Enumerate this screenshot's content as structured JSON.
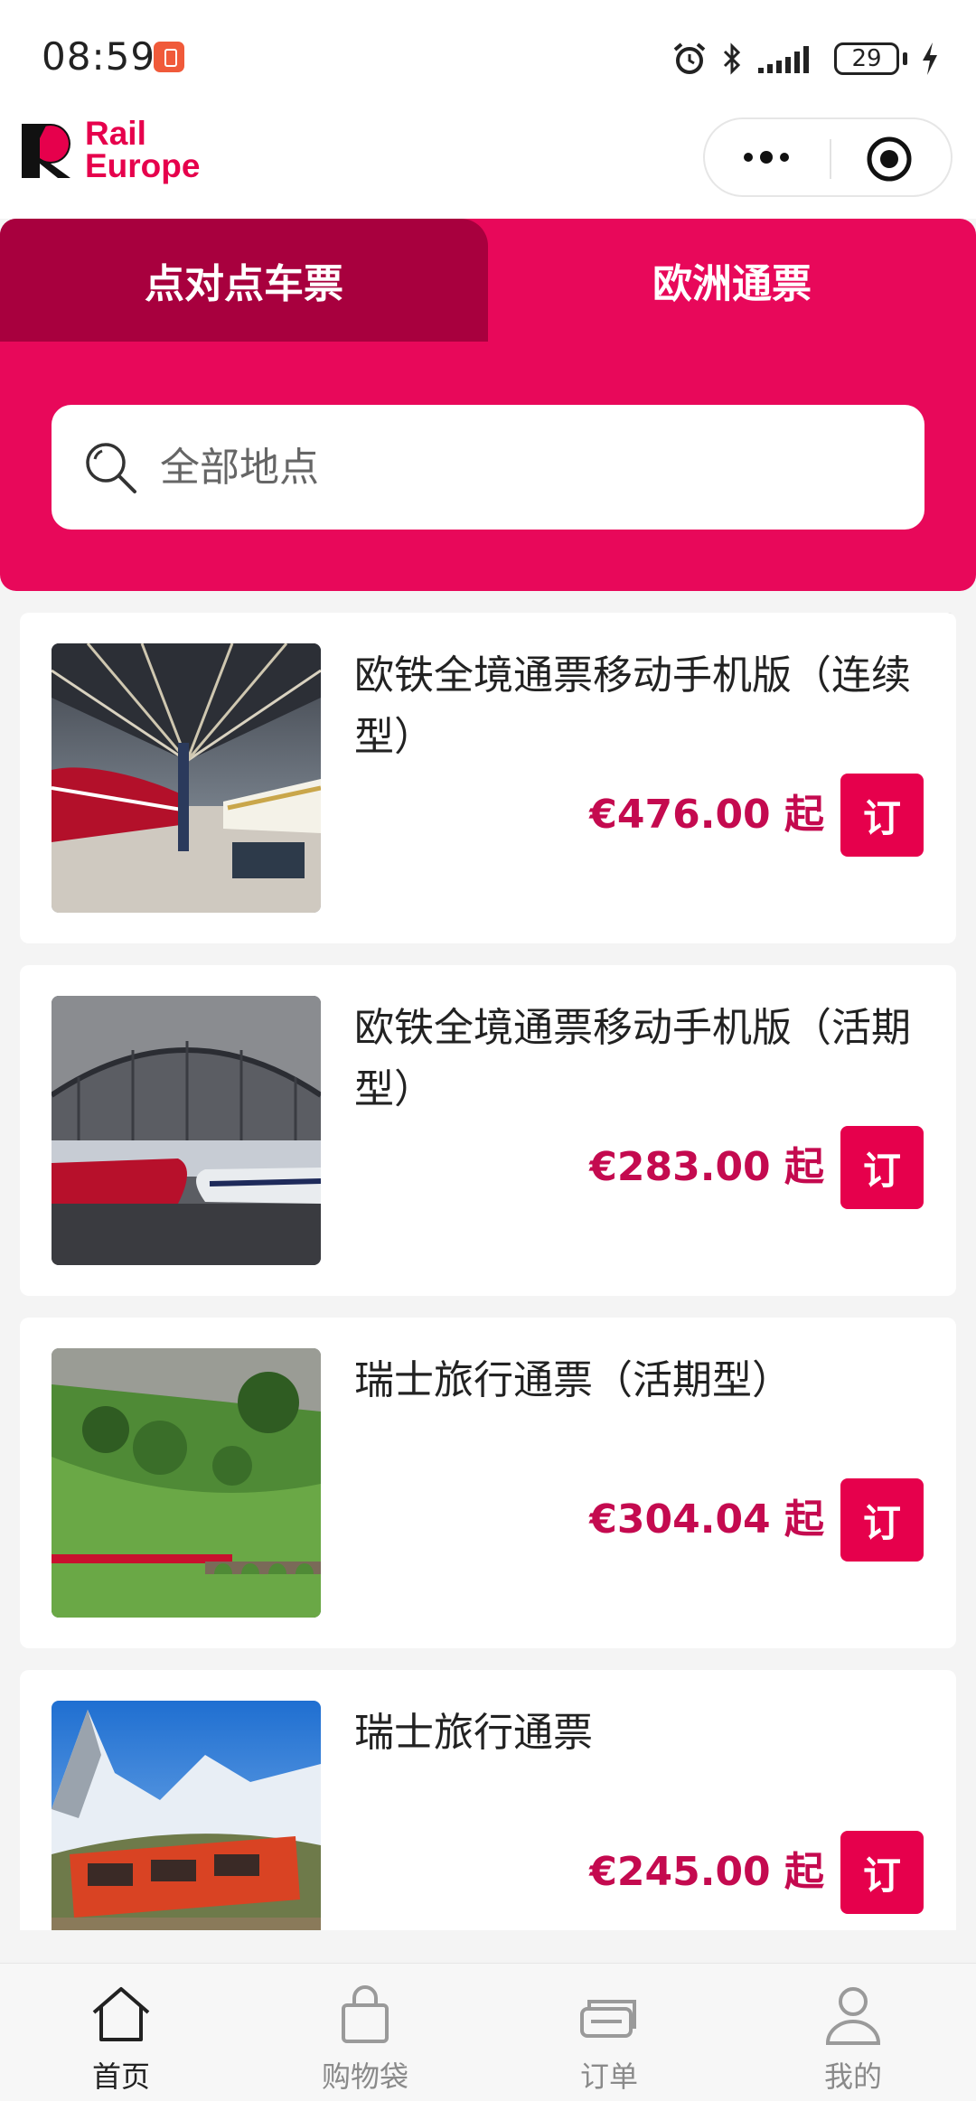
{
  "status_bar": {
    "time": "08:59",
    "battery": "29"
  },
  "header": {
    "logo_line1": "Rail",
    "logo_line2": "Europe",
    "more_icon": "more-dots-icon",
    "close_icon": "target-close-icon"
  },
  "tabs": [
    {
      "label": "点对点车票",
      "active": true
    },
    {
      "label": "欧洲通票",
      "active": false
    }
  ],
  "search": {
    "placeholder": "全部地点",
    "icon": "search-icon"
  },
  "products": [
    {
      "title": "欧铁全境通票移动手机版（连续型）",
      "price": "€476.00 起",
      "button": "订",
      "image": "train-station-platform"
    },
    {
      "title": "欧铁全境通票移动手机版（活期型）",
      "price": "€283.00 起",
      "button": "订",
      "image": "trains-under-station-roof"
    },
    {
      "title": "瑞士旅行通票（活期型）",
      "price": "€304.04 起",
      "button": "订",
      "image": "red-train-viaduct-green-hills"
    },
    {
      "title": "瑞士旅行通票",
      "price": "€245.00 起",
      "button": "订",
      "image": "red-train-matterhorn"
    }
  ],
  "tabbar": [
    {
      "label": "首页",
      "icon": "home-icon",
      "active": true
    },
    {
      "label": "购物袋",
      "icon": "shopping-bag-icon",
      "active": false
    },
    {
      "label": "订单",
      "icon": "orders-icon",
      "active": false
    },
    {
      "label": "我的",
      "icon": "profile-icon",
      "active": false
    }
  ],
  "colors": {
    "brand": "#e6004c",
    "tab_active": "#a8003e",
    "price": "#c40a4f"
  }
}
